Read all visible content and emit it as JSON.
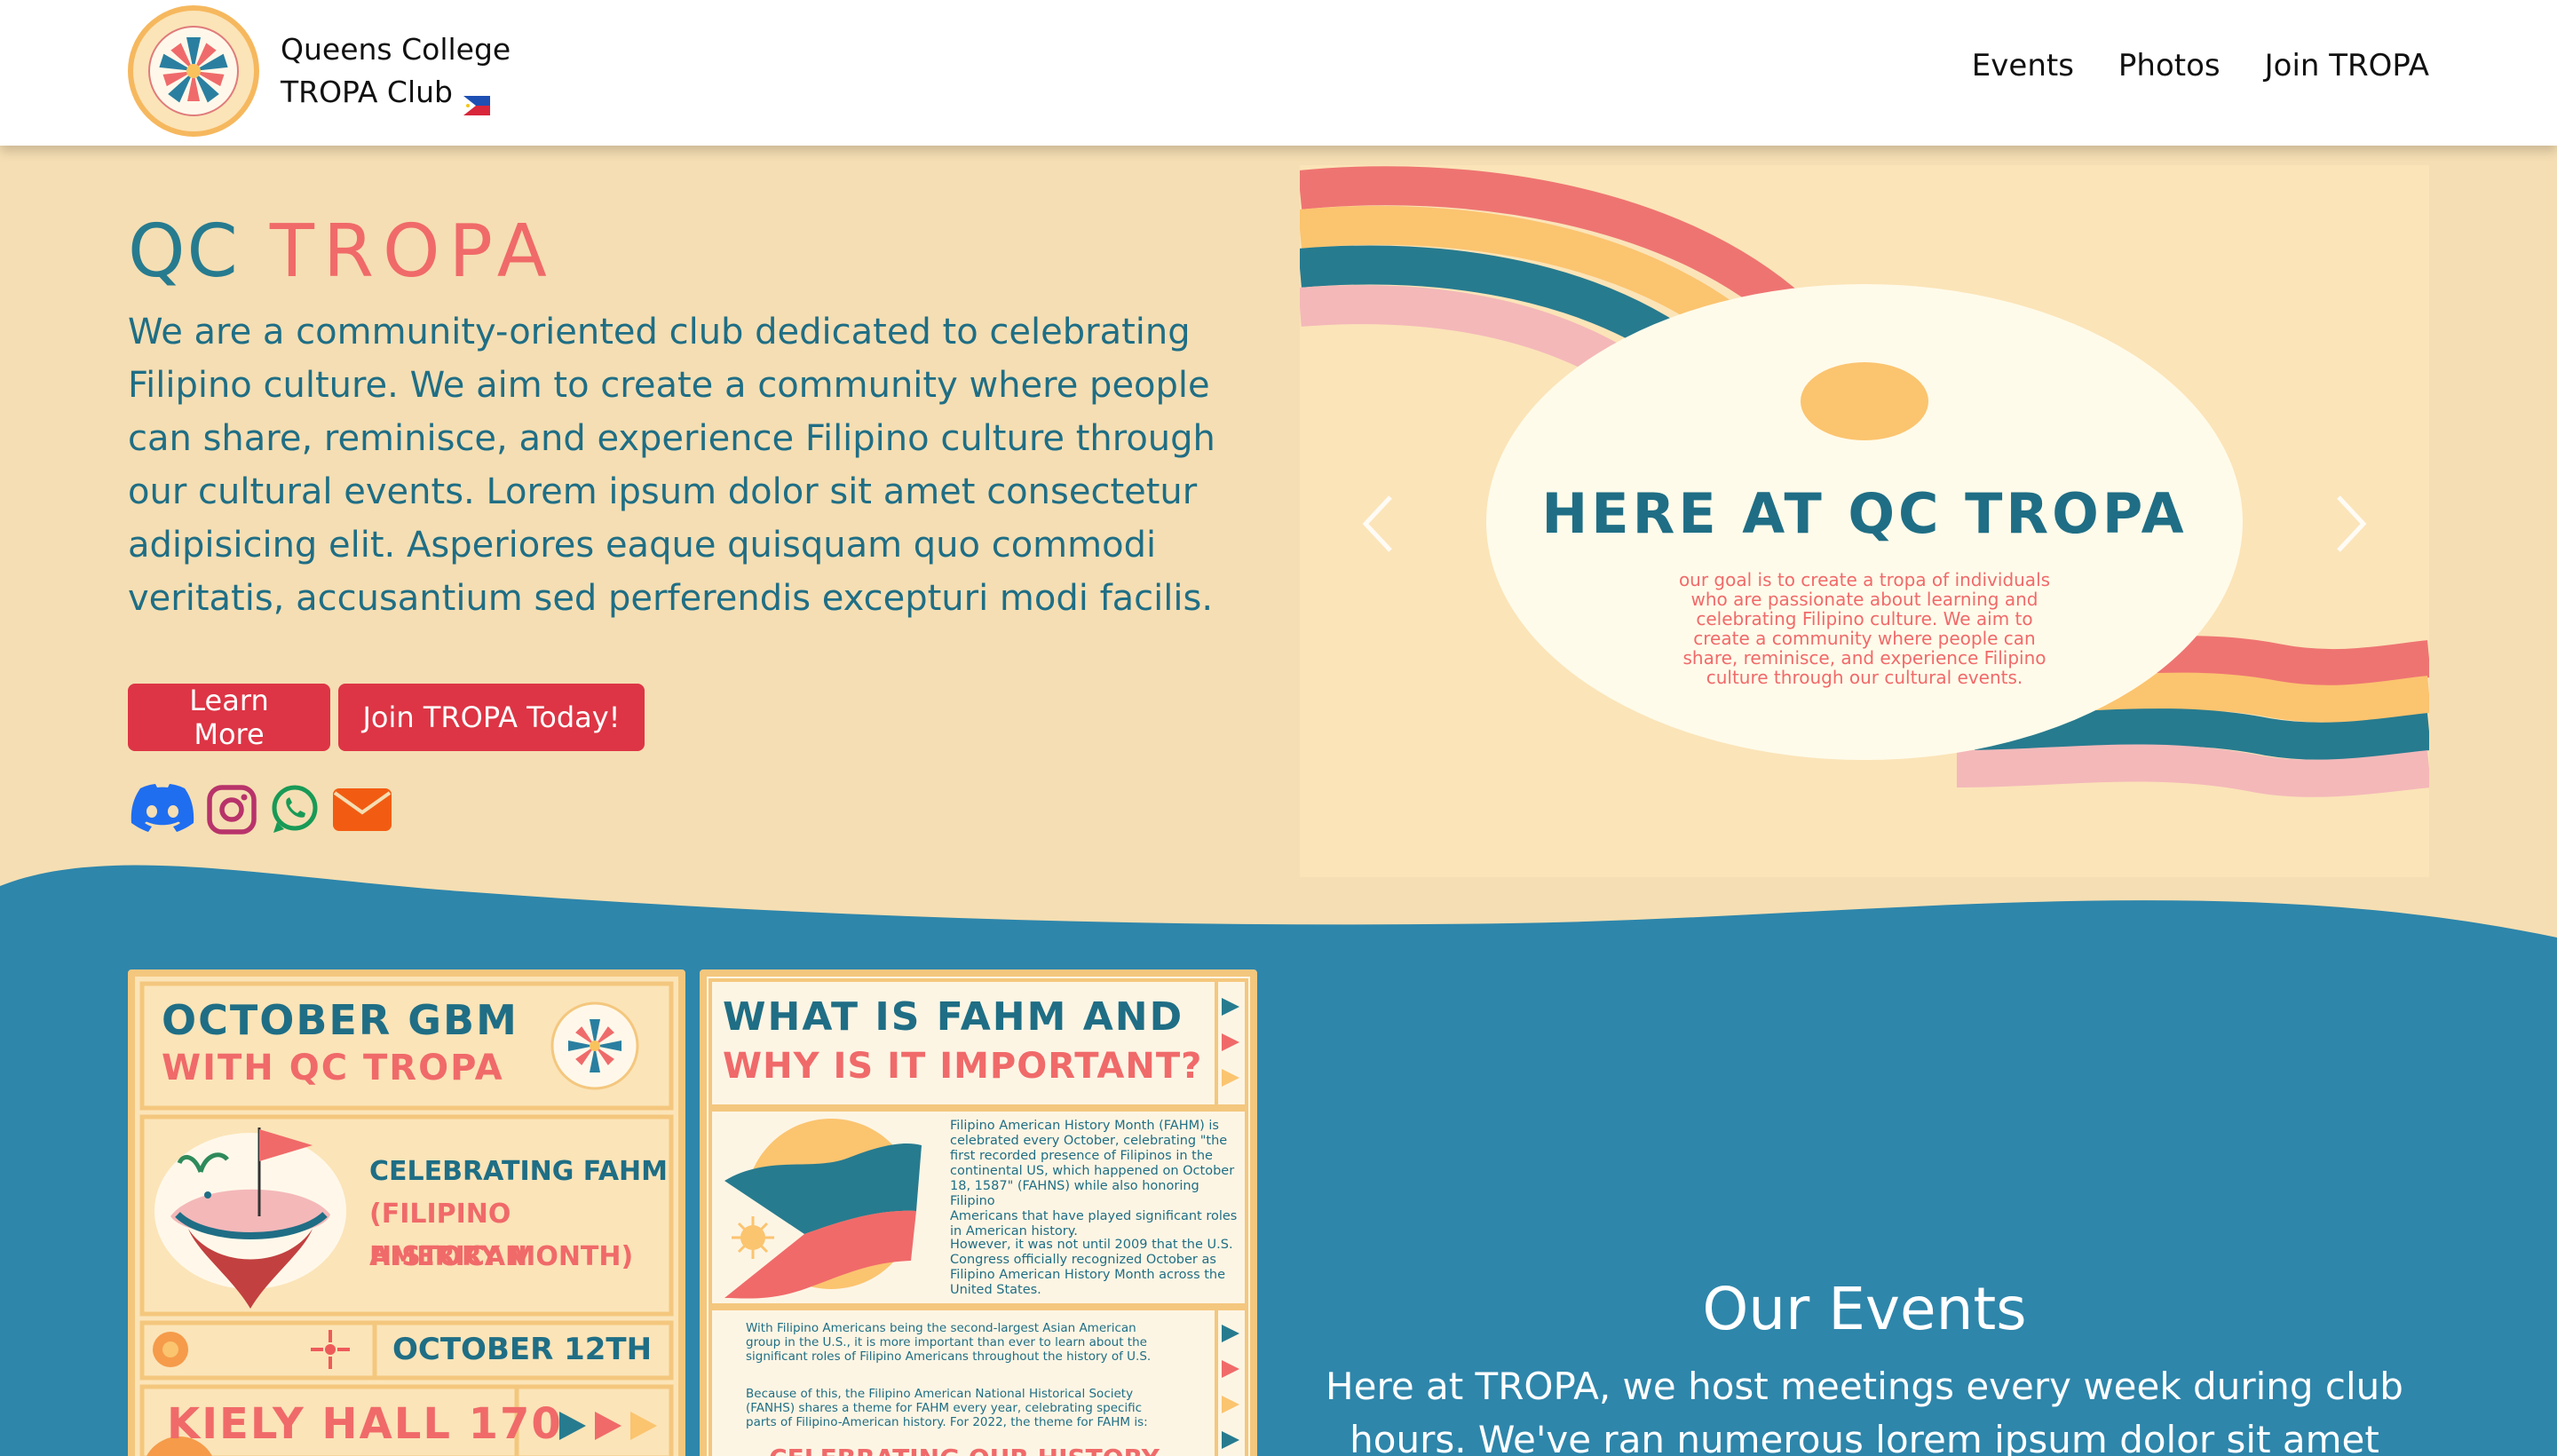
{
  "navbar": {
    "brand_line1": "Queens College",
    "brand_line2": "TROPA Club",
    "links": [
      "Events",
      "Photos",
      "Join TROPA"
    ]
  },
  "hero": {
    "title_qc": "QC",
    "title_tropa": "TROPA",
    "description": "We are a community-oriented club dedicated to celebrating Filipino culture. We aim to create a community where people can share, reminisce, and experience Filipino culture through our cultural events. Lorem ipsum dolor sit amet consectetur adipisicing elit. Asperiores eaque quisquam quo commodi veritatis, accusantium sed perferendis excepturi modi facilis.",
    "learn_more": "Learn More",
    "join_today": "Join TROPA Today!",
    "social_icons": [
      "discord-icon",
      "instagram-icon",
      "whatsapp-icon",
      "envelope-icon"
    ]
  },
  "carousel": {
    "heading": "HERE AT QC TROPA",
    "body_lines": [
      "our goal is to create a tropa of individuals",
      "who are passionate about learning and",
      "celebrating Filipino culture. We aim to",
      "create a community where people can",
      "share, reminisce, and experience Filipino",
      "culture through our cultural events."
    ]
  },
  "poster1": {
    "title1": "OCTOBER GBM",
    "title2": "WITH QC TROPA",
    "celebrating1": "CELEBRATING FAHM",
    "celebrating2": "(FILIPINO AMERICAN",
    "celebrating3": "HISTORY MONTH)",
    "date": "OCTOBER 12TH",
    "location": "KIELY HALL 170"
  },
  "poster2": {
    "title1": "WHAT IS FAHM AND",
    "title2": "WHY IS IT IMPORTANT?",
    "para1": [
      "Filipino American History Month (FAHM) is",
      "celebrated every October, celebrating \"the",
      "first recorded presence of Filipinos in the",
      "continental US, which happened on  October",
      "18, 1587\" (FAHNS) while also honoring Filipino",
      "Americans that have played significant roles",
      "in American history."
    ],
    "para2": [
      "However, it was not until 2009 that the U.S.",
      "Congress officially recognized October as",
      "Filipino American History Month across the",
      "United States."
    ],
    "para3": [
      "With Filipino Americans being the second-largest Asian American",
      "group in the U.S., it is more important than ever to learn about the",
      "significant roles of Filipino Americans throughout the history of U.S."
    ],
    "para4": [
      "Because of this, the Filipino American National Historical Society",
      "(FANHS) shares a theme for FAHM every year, celebrating specific",
      "parts of Filipino-American history. For 2022,  the theme for FAHM is:"
    ],
    "banner": "CELEBRATING OUR HISTORY"
  },
  "events": {
    "title": "Our Events",
    "description": "Here at TROPA, we host meetings every week during club hours. We've ran numerous lorem ipsum dolor sit amet consectetur"
  },
  "colors": {
    "beige": "#f5deb3",
    "teal": "#277b8f",
    "coral": "#f06a6a",
    "red_button": "#dd3545",
    "blue_section": "#2e86ab",
    "yellow": "#fbc46f"
  }
}
